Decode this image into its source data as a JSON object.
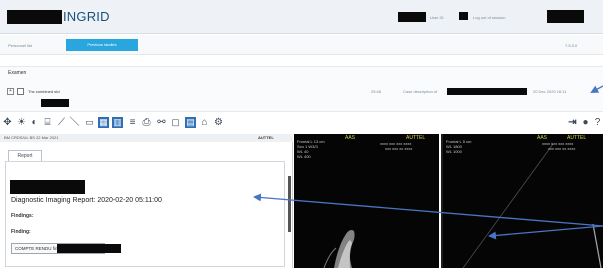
{
  "header": {
    "app_title": "INGRID",
    "right_text_1": "User ID",
    "right_text_2": "Log out of session",
    "version": "7.5.3.0"
  },
  "subbar": {
    "left_label": "Personnel list",
    "active_tab": "Previous studies"
  },
  "exams": {
    "label": "Examen",
    "row_title": "Thx combined std",
    "row_time": "25:48",
    "row_status": "Case description of",
    "row_date": "20 Dec 2020 16:11"
  },
  "toolbar": {
    "icons": [
      "move-icon",
      "sun-icon",
      "contrast-icon",
      "scale-icon",
      "measure-line-icon",
      "rectangle-icon",
      "layout-grid-icon",
      "layout-split-icon",
      "list-icon",
      "print-icon",
      "link-icon",
      "window-icon",
      "monitor-icon",
      "key-image-icon",
      "settings-icon"
    ],
    "right_icons": [
      "arrow-back-icon",
      "info-icon",
      "help-icon"
    ]
  },
  "report": {
    "header_text": "BM CRDS/UL BS   22 Mar 2021",
    "header_right": "AUTTEL",
    "tab_label": "Report",
    "title": "Diagnostic Imaging Report: 2020-02-20 05:11:00",
    "findings_label": "Findings:",
    "finding_label": "Finding:",
    "button_label": "COMPTE RENDU final"
  },
  "viewport_left": {
    "top_center": "AAS",
    "top_right": "AUTTEL",
    "left_lines": [
      "Frontal L 13 cm",
      "Scn 1 W3/3",
      "WL 40",
      "WL 400"
    ],
    "right_lines": [
      "xxxx xxx xxx xxxx",
      "xxx xxx xx xxxx"
    ]
  },
  "viewport_right": {
    "top_center": "AAS",
    "top_right": "AUTTEL",
    "left_lines": [
      "Frontal L 5 cm",
      "WL 1800",
      "WL 1000"
    ],
    "right_lines": [
      "xxxx xxx xxx xxxx",
      "xxx xxx xx xxxx"
    ]
  },
  "colors": {
    "accent": "#2aa6de",
    "brand": "#1a4f7a",
    "arrow": "#4a74c4",
    "overlay_text": "#d8d84a"
  }
}
